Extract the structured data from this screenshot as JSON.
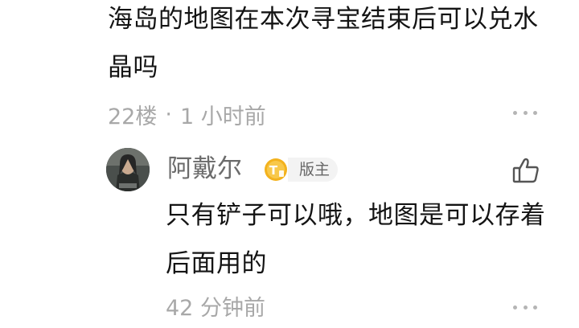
{
  "post": {
    "text": "海岛的地图在本次寻宝结束后可以兑水晶吗",
    "floor": "22楼",
    "separator": "·",
    "time": "1 小时前"
  },
  "reply": {
    "username": "阿戴尔",
    "level_badge": "T",
    "role_badge": "版主",
    "text": "只有铲子可以哦，地图是可以存着后面用的",
    "time": "42 分钟前"
  },
  "icons": {
    "more": "more-dots-icon",
    "like": "thumbs-up-icon",
    "level": "level-coin-icon"
  },
  "colors": {
    "text": "#141414",
    "meta": "#a8a8a8",
    "username": "#6b6b6b",
    "badge_gold": "#f3b21d"
  }
}
